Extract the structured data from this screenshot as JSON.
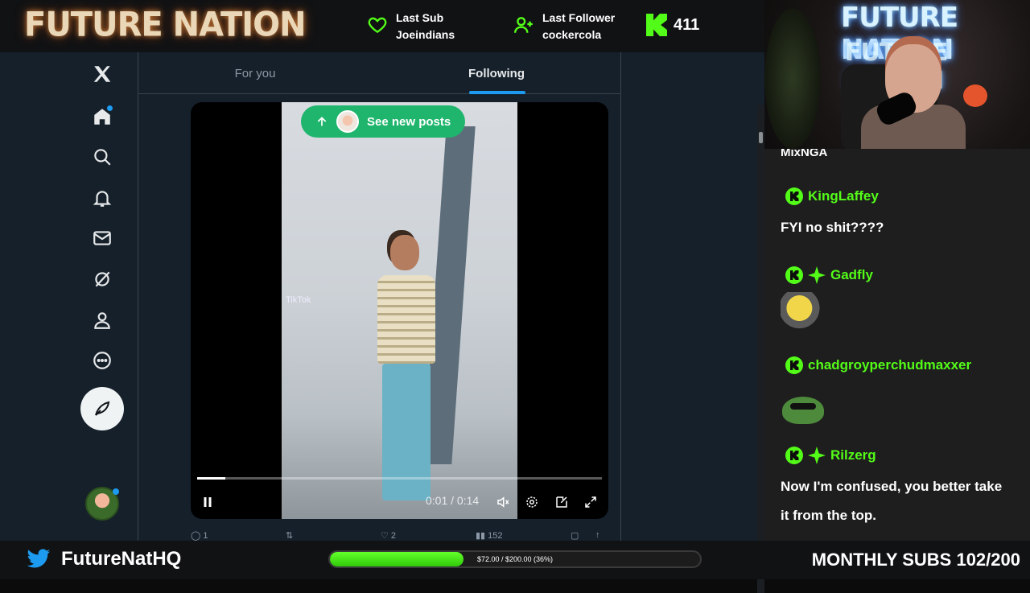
{
  "overlay": {
    "logo": "FUTURE NATION",
    "last_sub_label": "Last Sub",
    "last_sub_name": "Joeindians",
    "last_follower_label": "Last Follower",
    "last_follower_name": "cockercola",
    "kick_count": "411",
    "twitter_handle": "FutureNatHQ",
    "goal_text": "$72.00 / $200.00 (36%)",
    "goal_fraction": 0.36,
    "monthly_subs": "MONTHLY SUBS 102/200",
    "accent_green": "#53fc18"
  },
  "webcam": {
    "neon_line1": "FUTURE NATION",
    "neon_line2": "FUTURE NATION"
  },
  "twitter": {
    "tabs": [
      "For you",
      "Following"
    ],
    "active_tab": "Following",
    "see_new_posts": "See new posts",
    "video_time": "0:01 / 0:14",
    "video_progress": 0.07,
    "tiktok_watermark": "TikTok",
    "actions": {
      "replies": "1",
      "reposts": "",
      "likes": "2",
      "views": "152"
    },
    "nav_icons": [
      "x-logo-icon",
      "home-icon",
      "search-icon",
      "bell-icon",
      "mail-icon",
      "grok-icon",
      "profile-icon",
      "more-icon",
      "compose-icon"
    ]
  },
  "chat": {
    "cutoff_name": "MixNGA",
    "messages": [
      {
        "user": "KingLaffey",
        "text": "FYI no shit????",
        "badge_sub": false
      },
      {
        "user": "Gadfly",
        "text": "",
        "badge_sub": true,
        "emote": "emote-image"
      },
      {
        "user": "chadgroyperchudmaxxer",
        "text": "",
        "badge_sub": false,
        "emote": "pepe-emote"
      },
      {
        "user": "Rilzerg",
        "text": "Now I'm confused, you better take it from the top.",
        "badge_sub": true
      }
    ]
  }
}
